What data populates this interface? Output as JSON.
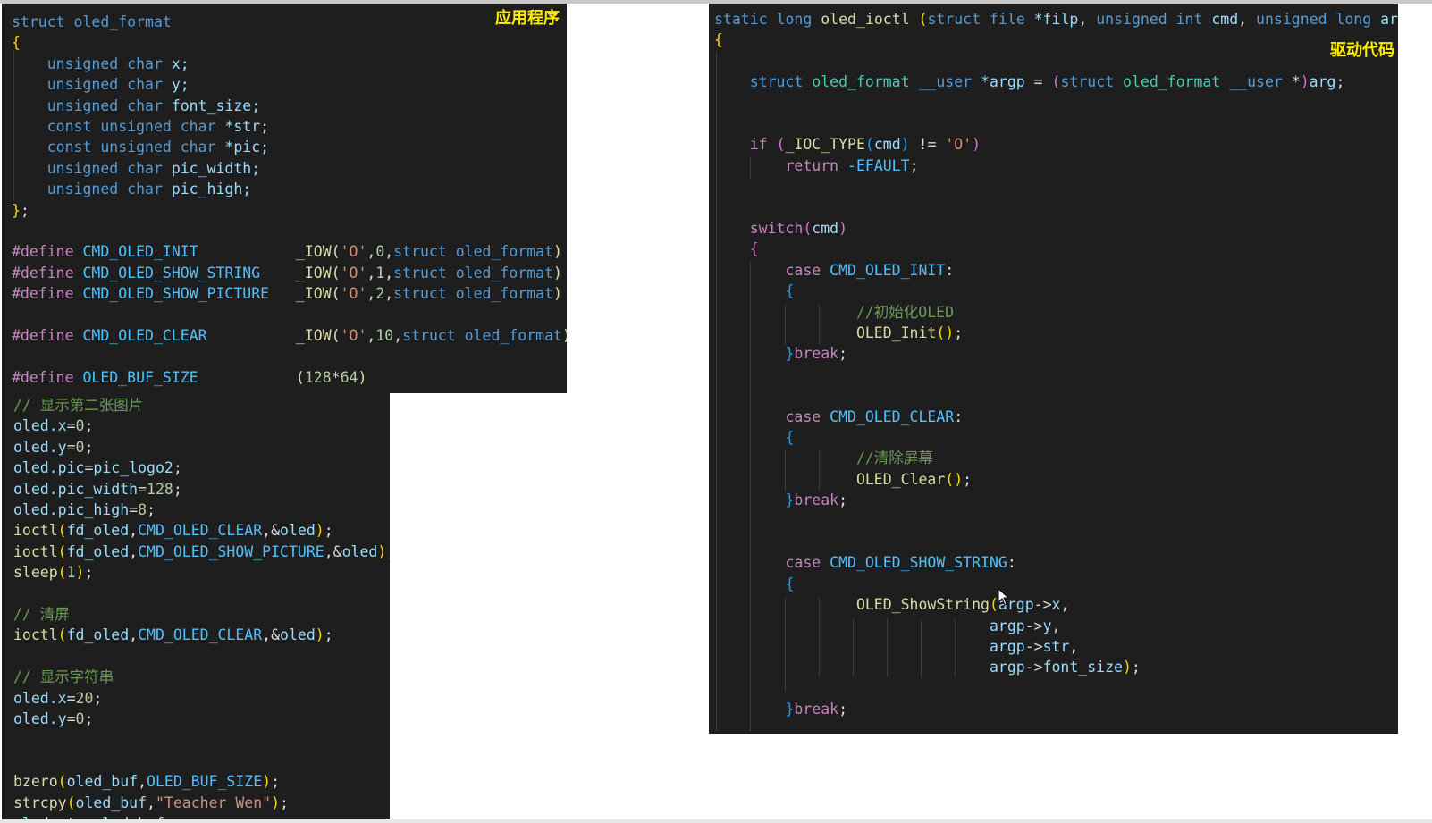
{
  "labels": {
    "app_code": "应用程序",
    "driver_code": "驱动代码"
  },
  "struct_panel": {
    "lines": [
      [
        [
          "struct oled_format",
          "kw"
        ]
      ],
      [
        [
          "{",
          "br"
        ]
      ],
      [
        [
          "    unsigned char ",
          "kw"
        ],
        [
          "x;",
          "vr"
        ]
      ],
      [
        [
          "    unsigned char ",
          "kw"
        ],
        [
          "y;",
          "vr"
        ]
      ],
      [
        [
          "    unsigned char ",
          "kw"
        ],
        [
          "font_size;",
          "vr"
        ]
      ],
      [
        [
          "    const unsigned char ",
          "kw"
        ],
        [
          "*str;",
          "vr"
        ]
      ],
      [
        [
          "    const unsigned char ",
          "kw"
        ],
        [
          "*pic;",
          "vr"
        ]
      ],
      [
        [
          "    unsigned char ",
          "kw"
        ],
        [
          "pic_width;",
          "vr"
        ]
      ],
      [
        [
          "    unsigned char ",
          "kw"
        ],
        [
          "pic_high;",
          "vr"
        ]
      ],
      [
        [
          "}",
          "br"
        ],
        [
          ";",
          "pu"
        ]
      ],
      [],
      [
        [
          "#define ",
          "ctrl"
        ],
        [
          "CMD_OLED_INIT           ",
          "mac"
        ],
        [
          "_IOW(",
          "fn"
        ],
        [
          "'O'",
          "st"
        ],
        [
          ",",
          "pu"
        ],
        [
          "0",
          "nm"
        ],
        [
          ",",
          "pu"
        ],
        [
          "struct oled_format",
          "kw"
        ],
        [
          ")",
          "fn"
        ]
      ],
      [
        [
          "#define ",
          "ctrl"
        ],
        [
          "CMD_OLED_SHOW_STRING    ",
          "mac"
        ],
        [
          "_IOW(",
          "fn"
        ],
        [
          "'O'",
          "st"
        ],
        [
          ",",
          "pu"
        ],
        [
          "1",
          "nm"
        ],
        [
          ",",
          "pu"
        ],
        [
          "struct oled_format",
          "kw"
        ],
        [
          ")",
          "fn"
        ]
      ],
      [
        [
          "#define ",
          "ctrl"
        ],
        [
          "CMD_OLED_SHOW_PICTURE   ",
          "mac"
        ],
        [
          "_IOW(",
          "fn"
        ],
        [
          "'O'",
          "st"
        ],
        [
          ",",
          "pu"
        ],
        [
          "2",
          "nm"
        ],
        [
          ",",
          "pu"
        ],
        [
          "struct oled_format",
          "kw"
        ],
        [
          ")",
          "fn"
        ]
      ],
      [],
      [
        [
          "#define ",
          "ctrl"
        ],
        [
          "CMD_OLED_CLEAR          ",
          "mac"
        ],
        [
          "_IOW(",
          "fn"
        ],
        [
          "'O'",
          "st"
        ],
        [
          ",",
          "pu"
        ],
        [
          "10",
          "nm"
        ],
        [
          ",",
          "pu"
        ],
        [
          "struct oled_format",
          "kw"
        ],
        [
          ")",
          "fn"
        ]
      ],
      [],
      [
        [
          "#define ",
          "ctrl"
        ],
        [
          "OLED_BUF_SIZE           ",
          "mac"
        ],
        [
          "(",
          "fn"
        ],
        [
          "128",
          "nm"
        ],
        [
          "*",
          "pu"
        ],
        [
          "64",
          "nm"
        ],
        [
          ")",
          "fn"
        ]
      ]
    ]
  },
  "app_panel": {
    "lines": [
      [
        [
          "// 显示第二张图片",
          "cm"
        ]
      ],
      [
        [
          "oled.x",
          "vr"
        ],
        [
          "=",
          "pu"
        ],
        [
          "0",
          "nm"
        ],
        [
          ";",
          "pu"
        ]
      ],
      [
        [
          "oled.y",
          "vr"
        ],
        [
          "=",
          "pu"
        ],
        [
          "0",
          "nm"
        ],
        [
          ";",
          "pu"
        ]
      ],
      [
        [
          "oled.pic",
          "vr"
        ],
        [
          "=",
          "pu"
        ],
        [
          "pic_logo2",
          "vr"
        ],
        [
          ";",
          "pu"
        ]
      ],
      [
        [
          "oled.pic_width",
          "vr"
        ],
        [
          "=",
          "pu"
        ],
        [
          "128",
          "nm"
        ],
        [
          ";",
          "pu"
        ]
      ],
      [
        [
          "oled.pic_high",
          "vr"
        ],
        [
          "=",
          "pu"
        ],
        [
          "8",
          "nm"
        ],
        [
          ";",
          "pu"
        ]
      ],
      [
        [
          "ioctl",
          "fn"
        ],
        [
          "(",
          "br"
        ],
        [
          "fd_oled",
          "vr"
        ],
        [
          ",",
          "pu"
        ],
        [
          "CMD_OLED_CLEAR",
          "mac"
        ],
        [
          ",&",
          "pu"
        ],
        [
          "oled",
          "vr"
        ],
        [
          ")",
          "br"
        ],
        [
          ";",
          "pu"
        ]
      ],
      [
        [
          "ioctl",
          "fn"
        ],
        [
          "(",
          "br"
        ],
        [
          "fd_oled",
          "vr"
        ],
        [
          ",",
          "pu"
        ],
        [
          "CMD_OLED_SHOW_PICTURE",
          "mac"
        ],
        [
          ",&",
          "pu"
        ],
        [
          "oled",
          "vr"
        ],
        [
          ")",
          "br"
        ],
        [
          ";",
          "pu"
        ]
      ],
      [
        [
          "sleep",
          "fn"
        ],
        [
          "(",
          "br"
        ],
        [
          "1",
          "nm"
        ],
        [
          ")",
          "br"
        ],
        [
          ";",
          "pu"
        ]
      ],
      [],
      [
        [
          "// 清屏",
          "cm"
        ]
      ],
      [
        [
          "ioctl",
          "fn"
        ],
        [
          "(",
          "br"
        ],
        [
          "fd_oled",
          "vr"
        ],
        [
          ",",
          "pu"
        ],
        [
          "CMD_OLED_CLEAR",
          "mac"
        ],
        [
          ",&",
          "pu"
        ],
        [
          "oled",
          "vr"
        ],
        [
          ")",
          "br"
        ],
        [
          ";",
          "pu"
        ]
      ],
      [],
      [
        [
          "// 显示字符串",
          "cm"
        ]
      ],
      [
        [
          "oled.x",
          "vr"
        ],
        [
          "=",
          "pu"
        ],
        [
          "20",
          "nm"
        ],
        [
          ";",
          "pu"
        ]
      ],
      [
        [
          "oled.y",
          "vr"
        ],
        [
          "=",
          "pu"
        ],
        [
          "0",
          "nm"
        ],
        [
          ";",
          "pu"
        ]
      ],
      [],
      [],
      [
        [
          "bzero",
          "fn"
        ],
        [
          "(",
          "br"
        ],
        [
          "oled_buf",
          "vr"
        ],
        [
          ",",
          "pu"
        ],
        [
          "OLED_BUF_SIZE",
          "mac"
        ],
        [
          ")",
          "br"
        ],
        [
          ";",
          "pu"
        ]
      ],
      [
        [
          "strcpy",
          "fn"
        ],
        [
          "(",
          "br"
        ],
        [
          "oled_buf",
          "vr"
        ],
        [
          ",",
          "pu"
        ],
        [
          "\"Teacher Wen\"",
          "st"
        ],
        [
          ")",
          "br"
        ],
        [
          ";",
          "pu"
        ]
      ],
      [
        [
          "oled.str",
          "vr"
        ],
        [
          "=",
          "pu"
        ],
        [
          "oled_buf",
          "vr"
        ],
        [
          ";",
          "pu"
        ]
      ]
    ]
  },
  "driver_panel": {
    "lines": [
      [
        [
          "static long ",
          "kw"
        ],
        [
          "oled_ioctl ",
          "fn"
        ],
        [
          "(",
          "br"
        ],
        [
          "struct file ",
          "kw"
        ],
        [
          "*filp",
          "vr"
        ],
        [
          ", ",
          "pu"
        ],
        [
          "unsigned int ",
          "kw"
        ],
        [
          "cmd",
          "vr"
        ],
        [
          ", ",
          "pu"
        ],
        [
          "unsigned long ",
          "kw"
        ],
        [
          "arg",
          "vr"
        ],
        [
          ")",
          "br"
        ]
      ],
      [
        [
          "{",
          "br"
        ]
      ],
      [],
      [
        [
          "    struct ",
          "kw"
        ],
        [
          "oled_format ",
          "ty"
        ],
        [
          "__user ",
          "kw"
        ],
        [
          "*argp ",
          "vr"
        ],
        [
          "= ",
          "pu"
        ],
        [
          "(",
          "br2"
        ],
        [
          "struct ",
          "kw"
        ],
        [
          "oled_format ",
          "ty"
        ],
        [
          "__user ",
          "kw"
        ],
        [
          "*",
          "pu"
        ],
        [
          ")",
          "br2"
        ],
        [
          "arg",
          "vr"
        ],
        [
          ";",
          "pu"
        ]
      ],
      [],
      [],
      [
        [
          "    if ",
          "ctrl"
        ],
        [
          "(",
          "br2"
        ],
        [
          "_IOC_TYPE",
          "fn"
        ],
        [
          "(",
          "br3"
        ],
        [
          "cmd",
          "vr"
        ],
        [
          ")",
          "br3"
        ],
        [
          " != ",
          "pu"
        ],
        [
          "'O'",
          "st"
        ],
        [
          ")",
          "br2"
        ]
      ],
      [
        [
          "        return ",
          "ctrl"
        ],
        [
          "-EFAULT",
          "mac"
        ],
        [
          ";",
          "pu"
        ]
      ],
      [],
      [],
      [
        [
          "    switch",
          "ctrl"
        ],
        [
          "(",
          "br2"
        ],
        [
          "cmd",
          "vr"
        ],
        [
          ")",
          "br2"
        ]
      ],
      [
        [
          "    {",
          "br2"
        ]
      ],
      [
        [
          "        case ",
          "ctrl"
        ],
        [
          "CMD_OLED_INIT",
          "mac"
        ],
        [
          ":",
          "pu"
        ]
      ],
      [
        [
          "        {",
          "br3"
        ]
      ],
      [
        [
          "                //初始化OLED",
          "cm"
        ]
      ],
      [
        [
          "                OLED_Init",
          "fn"
        ],
        [
          "()",
          "br"
        ],
        [
          ";",
          "pu"
        ]
      ],
      [
        [
          "        }",
          "br3"
        ],
        [
          "break",
          "ctrl"
        ],
        [
          ";",
          "pu"
        ]
      ],
      [],
      [],
      [
        [
          "        case ",
          "ctrl"
        ],
        [
          "CMD_OLED_CLEAR",
          "mac"
        ],
        [
          ":",
          "pu"
        ]
      ],
      [
        [
          "        {",
          "br3"
        ]
      ],
      [
        [
          "                //清除屏幕",
          "cm"
        ]
      ],
      [
        [
          "                OLED_Clear",
          "fn"
        ],
        [
          "()",
          "br"
        ],
        [
          ";",
          "pu"
        ]
      ],
      [
        [
          "        }",
          "br3"
        ],
        [
          "break",
          "ctrl"
        ],
        [
          ";",
          "pu"
        ]
      ],
      [],
      [],
      [
        [
          "        case ",
          "ctrl"
        ],
        [
          "CMD_OLED_SHOW_STRING",
          "mac"
        ],
        [
          ":",
          "pu"
        ]
      ],
      [
        [
          "        {",
          "br3"
        ]
      ],
      [
        [
          "                OLED_ShowString",
          "fn"
        ],
        [
          "(",
          "br"
        ],
        [
          "argp",
          "vr"
        ],
        [
          "->",
          "pu"
        ],
        [
          "x",
          "vr"
        ],
        [
          ",",
          "pu"
        ]
      ],
      [
        [
          "                               argp",
          "vr"
        ],
        [
          "->",
          "pu"
        ],
        [
          "y",
          "vr"
        ],
        [
          ",",
          "pu"
        ]
      ],
      [
        [
          "                               argp",
          "vr"
        ],
        [
          "->",
          "pu"
        ],
        [
          "str",
          "vr"
        ],
        [
          ",",
          "pu"
        ]
      ],
      [
        [
          "                               argp",
          "vr"
        ],
        [
          "->",
          "pu"
        ],
        [
          "font_size",
          "vr"
        ],
        [
          ")",
          "br"
        ],
        [
          ";",
          "pu"
        ]
      ],
      [],
      [
        [
          "        }",
          "br3"
        ],
        [
          "break",
          "ctrl"
        ],
        [
          ";",
          "pu"
        ]
      ]
    ]
  }
}
